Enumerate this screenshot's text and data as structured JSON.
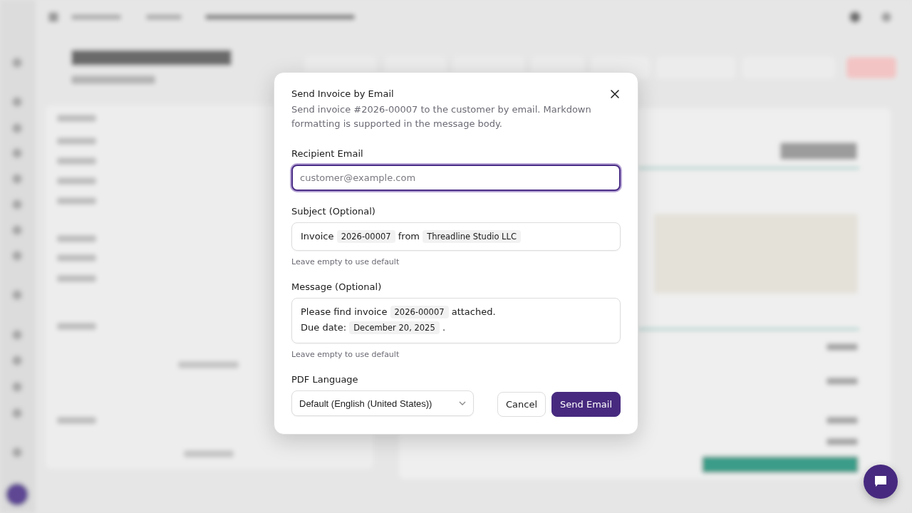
{
  "dialog": {
    "title": "Send Invoice by Email",
    "description": "Send invoice #2026-00007 to the customer by email. Markdown formatting is supported in the message body.",
    "recipient": {
      "label": "Recipient Email",
      "placeholder": "customer@example.com",
      "focused": true
    },
    "subject": {
      "label": "Subject (Optional)",
      "parts": [
        {
          "kind": "text",
          "text": "Invoice"
        },
        {
          "kind": "code",
          "text": "2026-00007"
        },
        {
          "kind": "text",
          "text": "from"
        },
        {
          "kind": "code",
          "text": "Threadline Studio LLC"
        }
      ],
      "hint": "Leave empty to use default"
    },
    "message": {
      "label": "Message (Optional)",
      "lines": [
        [
          {
            "kind": "text",
            "text": "Please find invoice"
          },
          {
            "kind": "code",
            "text": "2026-00007"
          },
          {
            "kind": "text",
            "text": "attached."
          }
        ],
        [
          {
            "kind": "text",
            "text": "Due date:"
          },
          {
            "kind": "code",
            "text": "December 20, 2025"
          },
          {
            "kind": "text",
            "text": "."
          }
        ]
      ],
      "hint": "Leave empty to use default"
    },
    "language": {
      "label": "PDF Language",
      "value": "Default (English (United States))"
    },
    "buttons": [
      {
        "label": "Cancel",
        "kind": "secondary"
      },
      {
        "label": "Send Email",
        "kind": "primary"
      }
    ]
  }
}
